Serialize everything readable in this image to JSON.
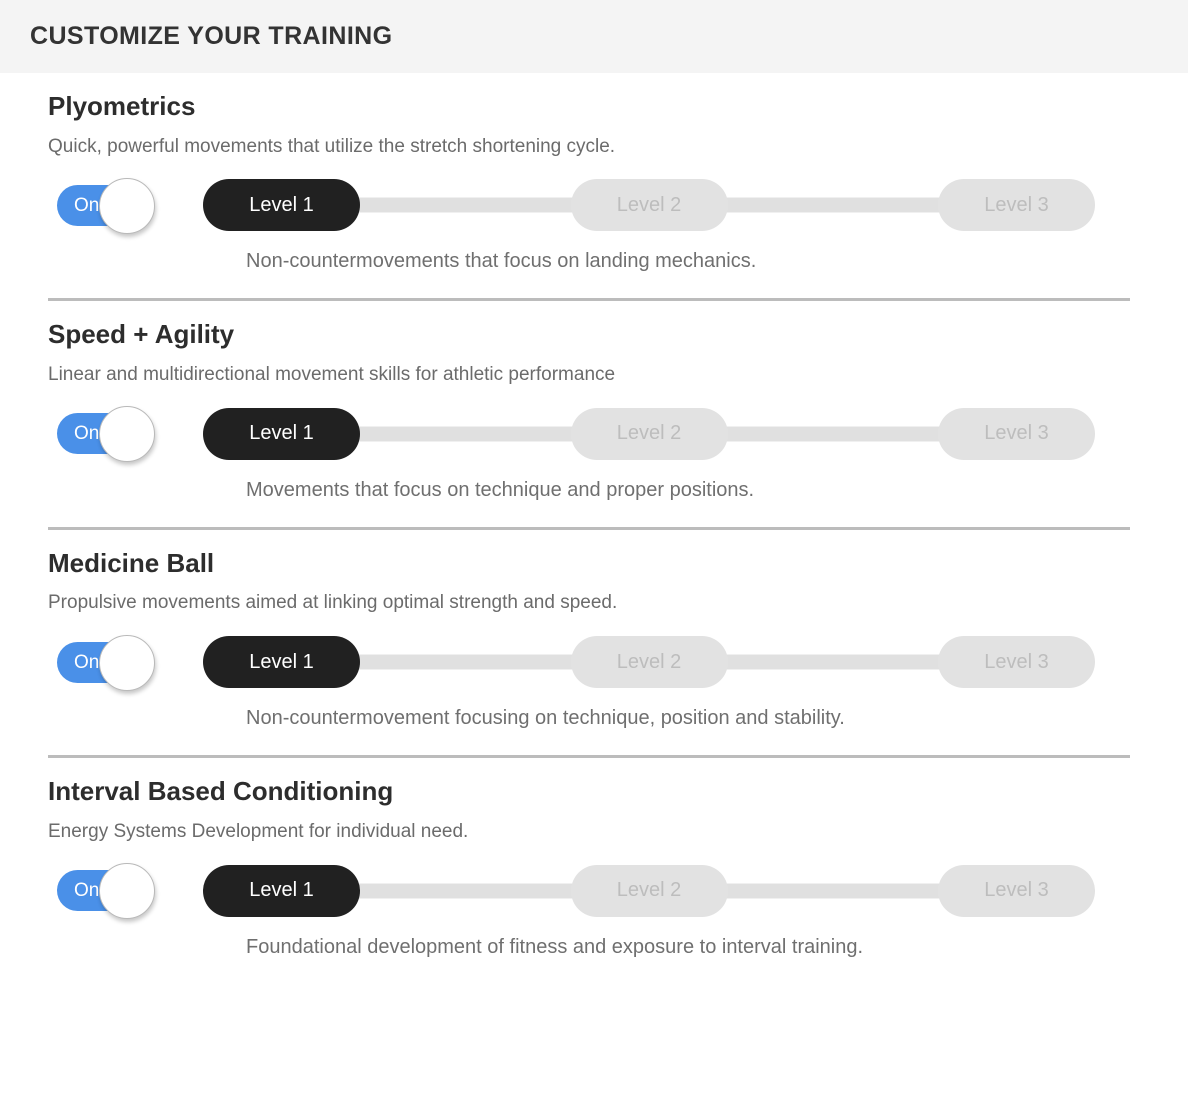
{
  "header": {
    "title": "CUSTOMIZE YOUR TRAINING"
  },
  "colors": {
    "header_background": "#f4f4f4",
    "toggle_on": "#4a90e8",
    "level_active": "#212121",
    "level_inactive": "#e2e2e2",
    "track": "#e0e0e0",
    "divider": "#bcbcbc"
  },
  "sections": [
    {
      "title": "Plyometrics",
      "description": "Quick, powerful movements that utilize the stretch shortening cycle.",
      "toggle": {
        "label": "On",
        "state": "on"
      },
      "levels": [
        {
          "label": "Level 1",
          "selected": true
        },
        {
          "label": "Level 2",
          "selected": false
        },
        {
          "label": "Level 3",
          "selected": false
        }
      ],
      "level_description": "Non-countermovements that focus on landing mechanics."
    },
    {
      "title": "Speed + Agility",
      "description": "Linear and multidirectional movement skills for athletic performance",
      "toggle": {
        "label": "On",
        "state": "on"
      },
      "levels": [
        {
          "label": "Level 1",
          "selected": true
        },
        {
          "label": "Level 2",
          "selected": false
        },
        {
          "label": "Level 3",
          "selected": false
        }
      ],
      "level_description": "Movements that focus on technique and proper positions."
    },
    {
      "title": "Medicine Ball",
      "description": "Propulsive movements aimed at linking optimal strength and speed.",
      "toggle": {
        "label": "On",
        "state": "on"
      },
      "levels": [
        {
          "label": "Level 1",
          "selected": true
        },
        {
          "label": "Level 2",
          "selected": false
        },
        {
          "label": "Level 3",
          "selected": false
        }
      ],
      "level_description": "Non-countermovement focusing on technique, position and stability."
    },
    {
      "title": "Interval Based Conditioning",
      "description": "Energy Systems Development for individual need.",
      "toggle": {
        "label": "On",
        "state": "on"
      },
      "levels": [
        {
          "label": "Level 1",
          "selected": true
        },
        {
          "label": "Level 2",
          "selected": false
        },
        {
          "label": "Level 3",
          "selected": false
        }
      ],
      "level_description": "Foundational development of fitness and exposure to interval training."
    }
  ]
}
